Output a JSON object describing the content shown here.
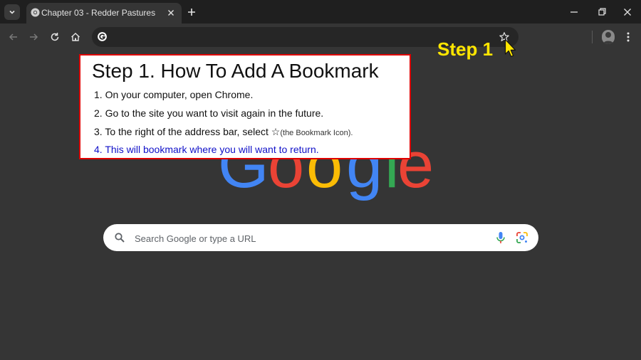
{
  "tab": {
    "title": "Chapter 03 - Redder Pastures"
  },
  "search": {
    "placeholder": "Search Google or type a URL"
  },
  "callout": {
    "title": "Step 1. How To Add A Bookmark",
    "steps": [
      "1. On your computer, open Chrome.",
      "2. Go to the site you want to visit again in the future.",
      "3. To the right of the address bar, select",
      "4. This will bookmark where you will want to return."
    ],
    "star_glyph": "☆",
    "step3_note": "(the Bookmark Icon)."
  },
  "step_label": "Step 1",
  "logo": {
    "letters": [
      "G",
      "o",
      "o",
      "g",
      "l",
      "e"
    ]
  },
  "colors": {
    "callout_border": "#e00000",
    "step_label": "#ffe600",
    "highlight_step": "#1010c8",
    "google_blue": "#4285f4",
    "google_red": "#ea4335",
    "google_yellow": "#fbbc05",
    "google_green": "#34a853"
  },
  "icons": [
    "tab-search-icon",
    "chrome-favicon-icon",
    "close-icon",
    "plus-icon",
    "minimize-icon",
    "restore-icon",
    "window-close-icon",
    "back-arrow-icon",
    "forward-arrow-icon",
    "reload-icon",
    "home-icon",
    "google-g-icon",
    "star-icon",
    "avatar-icon",
    "kebab-menu-icon",
    "search-icon",
    "microphone-icon",
    "google-lens-icon",
    "cursor-icon"
  ]
}
